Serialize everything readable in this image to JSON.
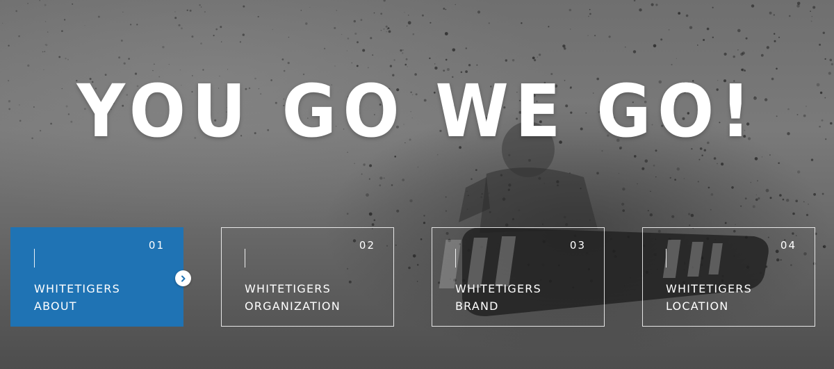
{
  "hero": {
    "headline": "YOU GO WE GO!"
  },
  "cards": [
    {
      "number": "01",
      "line1": "WHITETIGERS",
      "line2": "ABOUT",
      "active": true
    },
    {
      "number": "02",
      "line1": "WHITETIGERS",
      "line2": "ORGANIZATION",
      "active": false
    },
    {
      "number": "03",
      "line1": "WHITETIGERS",
      "line2": "BRAND",
      "active": false
    },
    {
      "number": "04",
      "line1": "WHITETIGERS",
      "line2": "LOCATION",
      "active": false
    }
  ],
  "colors": {
    "accent": "#1f73b4",
    "text": "#ffffff"
  },
  "icons": {
    "card_arrow": "chevron-right-icon"
  }
}
